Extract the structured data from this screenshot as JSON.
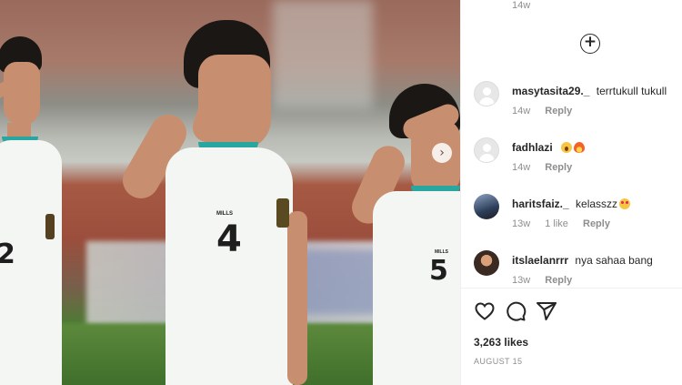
{
  "post": {
    "image_alt": "",
    "players": [
      {
        "number": "2"
      },
      {
        "number": "4"
      },
      {
        "number": "5"
      }
    ],
    "kit_brand": "MILLS"
  },
  "comments_panel": {
    "top_timestamp": "14w",
    "load_more_icon": "plus-circle-icon",
    "comments": [
      {
        "username": "masytasita29._",
        "text": "terrtukull tukull",
        "time": "14w",
        "likes": "",
        "reply": "Reply",
        "avatar": "default-avatar-icon"
      },
      {
        "username": "fadhlazi",
        "text": "",
        "emojis": [
          "astonished-face-emoji",
          "fire-emoji"
        ],
        "time": "14w",
        "likes": "",
        "reply": "Reply",
        "avatar": "default-avatar-icon"
      },
      {
        "username": "haritsfaiz._",
        "text": "kelasszz",
        "emojis": [
          "heart-eyes-emoji"
        ],
        "time": "13w",
        "likes": "1 like",
        "reply": "Reply",
        "avatar": "photo-avatar"
      },
      {
        "username": "itslaelanrrr",
        "text": "nya sahaa bang",
        "time": "13w",
        "likes": "",
        "reply": "Reply",
        "avatar": "photo-avatar"
      }
    ]
  },
  "actions": {
    "like_icon": "heart-icon",
    "comment_icon": "comment-bubble-icon",
    "share_icon": "paper-plane-icon"
  },
  "likes_count": "3,263 likes",
  "post_date": "AUGUST 15",
  "colors": {
    "text": "#262626",
    "muted": "#8e8e8e",
    "divider": "#efefef",
    "collar_accent": "#2aa6a0"
  }
}
